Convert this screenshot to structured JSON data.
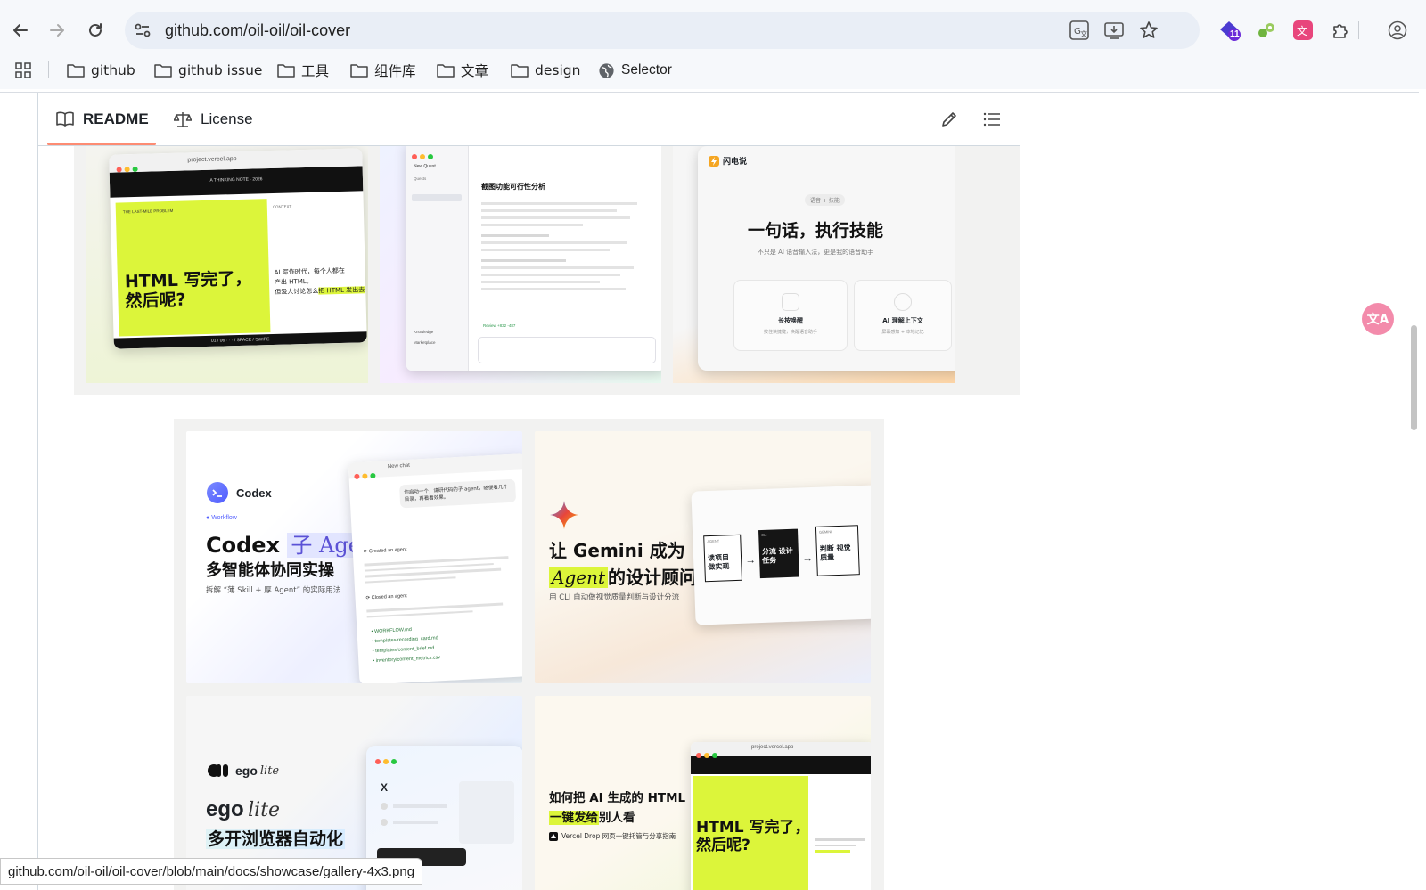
{
  "browser": {
    "url": "github.com/oil-oil/oil-cover",
    "bookmarks": [
      "github",
      "github issue",
      "工具",
      "组件库",
      "文章",
      "design",
      "Selector"
    ],
    "extension_badge": "11"
  },
  "readme": {
    "tabs": [
      {
        "label": "README",
        "active": true
      },
      {
        "label": "License",
        "active": false
      }
    ]
  },
  "gallery": {
    "tile1": {
      "url": "project.vercel.app",
      "banner": "A THINKING NOTE · 2026",
      "kicker": "THE LAST-MILE PROBLEM",
      "headline_line1": "HTML 写完了，",
      "headline_line2": "然后呢?",
      "aside_line1": "AI 写作时代，每个人都在",
      "aside_line2": "产出 HTML。",
      "aside_line3": "但没人讨论怎么",
      "aside_hl": "把 HTML 发出去",
      "context_label": "CONTEXT",
      "footer": "01 / 06 · · · / SPACE / SWIPE"
    },
    "tile2": {
      "title": "截图功能可行性分析",
      "new_quest": "New Quest",
      "sidebar_items": [
        "Quests",
        "Knowledge",
        "Marketplace"
      ],
      "review": "Review +832 -487"
    },
    "tile3": {
      "brand": "闪电说",
      "pill": "语音 + 技能",
      "headline": "一句话，执行技能",
      "sub": "不只是 AI 语音输入法，更是我的语音助手",
      "card1_title": "长按唤醒",
      "card1_sub": "按住快捷键，唤醒语音助手",
      "card2_title": "AI 理解上下文",
      "card2_sub": "屏幕感知 + 本地记忆"
    },
    "codex": {
      "brand": "Codex",
      "kicker": "Workflow",
      "title_a": "Codex ",
      "title_hl": "子 Agent",
      "title_line2": "多智能体协同实操",
      "sub": "拆解 “薄 Skill + 厚 Agent” 的实际用法",
      "chat_title": "New chat",
      "bubble": "你启动一个，请研代码的子 agent，随便看几个目录，再看看效果。",
      "step1": "Created an agent",
      "step2": "Closed an agent",
      "files": [
        "WORKFLOW.md",
        "templates/recording_card.md",
        "templates/content_brief.md",
        "inventory/content_metrics.csv"
      ]
    },
    "gemini": {
      "title_a": "让 Gemini 成为",
      "title_hl": "Agent",
      "title_b": "的设计顾问",
      "sub": "用 CLI 自动做视觉质量判断与设计分流",
      "step1_tag": "AGENT",
      "step1": "读项目 做实现",
      "step2_tag": "CLI",
      "step2": "分流 设计任务",
      "step3_tag": "GEMINI",
      "step3": "判断 视觉质量"
    },
    "ego": {
      "brand": "ego",
      "brand_suffix": "lite",
      "title_a": "ego",
      "title_suffix": "lite",
      "title_line2": "多开浏览器自动化"
    },
    "vercel": {
      "title_line1": "如何把 AI 生成的 HTML",
      "title_hl": "一键发给",
      "title_line2_rest": "别人看",
      "sub": "Vercel Drop 网页一键托管与分享指南",
      "url": "project.vercel.app",
      "headline_line1": "HTML 写完了，",
      "headline_line2": "然后呢?"
    }
  },
  "status_bar": {
    "link": "github.com/oil-oil/oil-cover/blob/main/docs/showcase/gallery-4x3.png"
  },
  "colors": {
    "lime": "#dcf53a",
    "tab_underline": "#fd8c73",
    "gallery_bg": "#f2f2f1"
  }
}
